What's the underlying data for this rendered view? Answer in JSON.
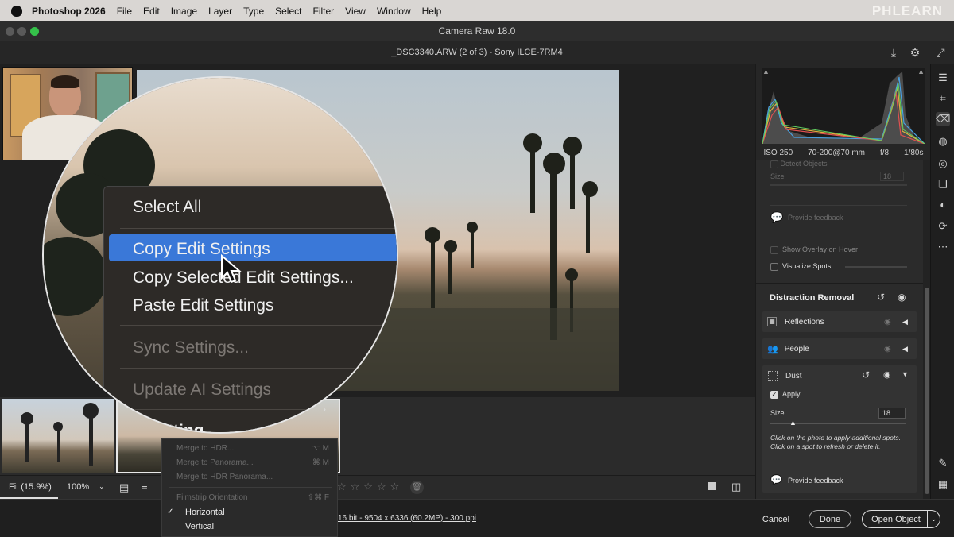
{
  "menubar": {
    "app": "Photoshop 2026",
    "items": [
      "File",
      "Edit",
      "Image",
      "Layer",
      "Type",
      "Select",
      "Filter",
      "View",
      "Window",
      "Help"
    ],
    "watermark": "PHLEARN"
  },
  "window": {
    "title": "Camera Raw 18.0"
  },
  "toolbar": {
    "filename": "_DSC3340.ARW (2 of 3)  -  Sony ILCE-7RM4"
  },
  "lens_menu": {
    "items": [
      "Select All",
      "Copy Edit Settings",
      "Copy Selected Edit Settings...",
      "Paste Edit Settings",
      "Sync Settings...",
      "Update AI Settings"
    ],
    "partial": "tting"
  },
  "popup_menu": {
    "items": [
      {
        "label": "Merge to HDR...",
        "shortcut": "⌥ M"
      },
      {
        "label": "Merge to Panorama...",
        "shortcut": "⌘ M"
      },
      {
        "label": "Merge to HDR Panorama...",
        "shortcut": ""
      },
      {
        "label": "Filmstrip Orientation",
        "shortcut": "⇧⌘ F"
      },
      {
        "label": "Horizontal",
        "check": "✓"
      },
      {
        "label": "Vertical"
      }
    ]
  },
  "status": {
    "zoom_fit": "Fit (15.9%)",
    "zoom_100": "100%",
    "file_info": "16 bit - 9504 x 6336 (60.2MP) - 300 ppi"
  },
  "exif": {
    "iso": "ISO 250",
    "lens": "70-200@70 mm",
    "aperture": "f/8",
    "shutter": "1/80s"
  },
  "panel": {
    "detect_objects": "Detect Objects",
    "size_label": "Size",
    "size_dim_value": "18",
    "feedback1": "Provide feedback",
    "show_overlay": "Show Overlay on Hover",
    "visualize_spots": "Visualize Spots",
    "section": "Distraction Removal",
    "reflections": "Reflections",
    "people": "People",
    "dust": "Dust",
    "apply": "Apply",
    "size": "Size",
    "size_value": "18",
    "hint": "Click on the photo to apply additional spots. Click on a spot to refresh or delete it.",
    "feedback2": "Provide feedback"
  },
  "buttons": {
    "cancel": "Cancel",
    "done": "Done",
    "open": "Open Object"
  },
  "colors": {
    "highlight": "#3a78d8",
    "panel": "#2b2b2b",
    "accent_white": "#f0f0f0"
  }
}
